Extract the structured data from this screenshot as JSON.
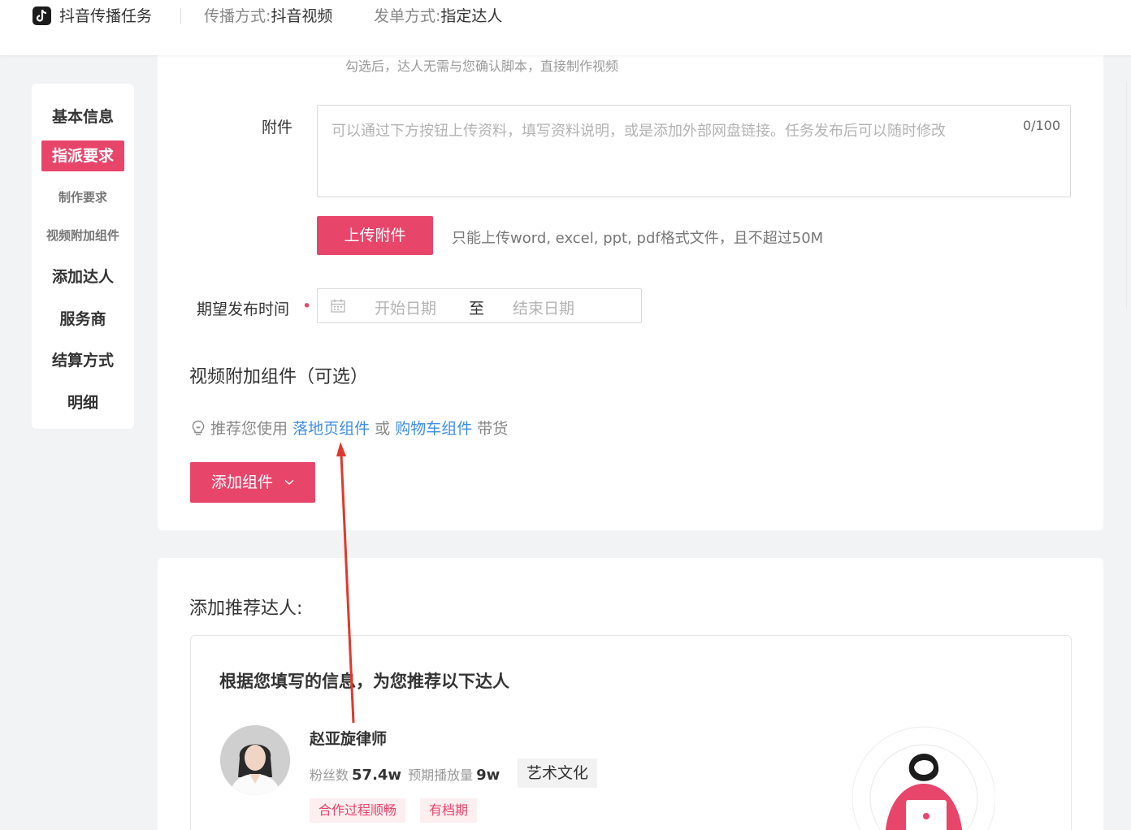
{
  "header": {
    "app_title": "抖音传播任务",
    "spread_label": "传播方式:",
    "spread_value": "抖音视频",
    "order_label": "发单方式:",
    "order_value": "指定达人"
  },
  "sidebar": {
    "items": [
      {
        "label": "基本信息"
      },
      {
        "label": "指派要求"
      },
      {
        "label": "制作要求"
      },
      {
        "label": "视频附加组件"
      },
      {
        "label": "添加达人"
      },
      {
        "label": "服务商"
      },
      {
        "label": "结算方式"
      },
      {
        "label": "明细"
      }
    ]
  },
  "form": {
    "top_hint": "勾选后，达人无需与您确认脚本，直接制作视频",
    "attachment_label": "附件",
    "attachment_placeholder": "可以通过下方按钮上传资料，填写资料说明，或是添加外部网盘链接。任务发布后可以随时修改",
    "attachment_counter": "0/100",
    "upload_button": "上传附件",
    "upload_note": "只能上传word, excel, ppt, pdf格式文件，且不超过50M",
    "time_label": "期望发布时间",
    "required_mark": "•",
    "start_placeholder": "开始日期",
    "range_separator": "至",
    "end_placeholder": "结束日期",
    "section_title": "视频附加组件（可选）",
    "recommend_prefix": "推荐您使用",
    "link_landing": "落地页组件",
    "recommend_or": "或",
    "link_cart": "购物车组件",
    "recommend_suffix": "带货",
    "add_component_button": "添加组件"
  },
  "recommend": {
    "title": "添加推荐达人:",
    "headline": "根据您填写的信息，为您推荐以下达人",
    "kol": {
      "name": "赵亚旋律师",
      "fans_label": "粉丝数",
      "fans_value": "57.4w",
      "plays_label": "预期播放量",
      "plays_value": "9w",
      "category": "艺术文化",
      "tags": [
        "合作过程顺畅",
        "有档期"
      ]
    }
  },
  "colors": {
    "brand": "#e8456b",
    "link": "#3e8ee6",
    "arrow": "#e0392b"
  }
}
